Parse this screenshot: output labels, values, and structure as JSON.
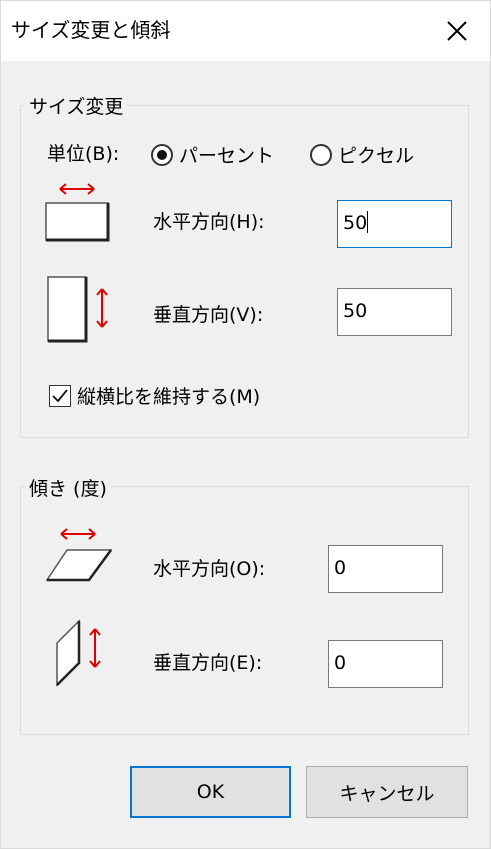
{
  "window": {
    "title": "サイズ変更と傾斜"
  },
  "resize": {
    "group_label": "サイズ変更",
    "units_label": "単位(B):",
    "units_underline": "B",
    "unit_options": [
      {
        "label": "パーセント",
        "selected": true
      },
      {
        "label": "ピクセル",
        "selected": false
      }
    ],
    "horizontal_label": "水平方向(H):",
    "horizontal_value": "50",
    "vertical_label": "垂直方向(V):",
    "vertical_value": "50",
    "keep_ratio_label": "縦横比を維持する(M)",
    "keep_ratio_checked": true
  },
  "skew": {
    "group_label": "傾き (度)",
    "horizontal_label": "水平方向(O):",
    "horizontal_value": "0",
    "vertical_label": "垂直方向(E):",
    "vertical_value": "0"
  },
  "buttons": {
    "ok": "OK",
    "cancel": "キャンセル"
  },
  "colors": {
    "arrow": "#e00000",
    "focus": "#0078d7",
    "background": "#f0f0f0"
  }
}
